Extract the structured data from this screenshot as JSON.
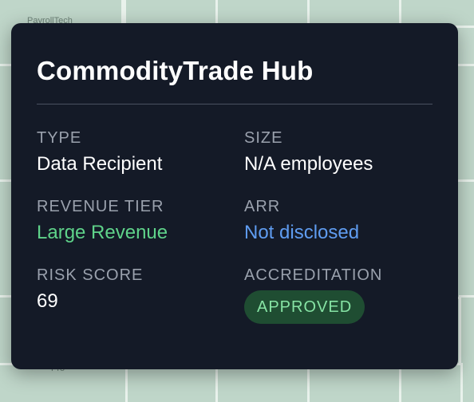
{
  "background": {
    "label_top": "PayrollTech",
    "label_bottom": "Pro"
  },
  "card": {
    "title": "CommodityTrade Hub",
    "fields": [
      {
        "label": "TYPE",
        "value": "Data Recipient"
      },
      {
        "label": "SIZE",
        "value": "N/A employees"
      },
      {
        "label": "REVENUE TIER",
        "value": "Large Revenue",
        "value_color": "#5fd38a"
      },
      {
        "label": "ARR",
        "value": "Not disclosed",
        "value_color": "#5f9cf0"
      },
      {
        "label": "RISK SCORE",
        "value": "69"
      },
      {
        "label": "ACCREDITATION",
        "badge": "APPROVED",
        "badge_bg": "#1f4d32",
        "badge_color": "#86e3a4"
      }
    ]
  },
  "colors": {
    "card_bg": "#141a27",
    "map_bg": "#c3d9cd"
  }
}
